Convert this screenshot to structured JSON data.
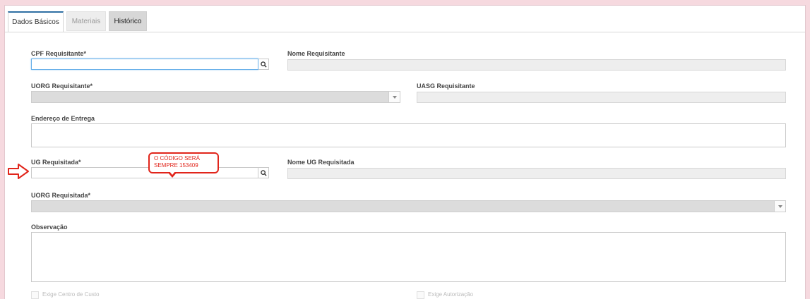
{
  "tabs": [
    "Dados Básicos",
    "Materiais",
    "Histórico"
  ],
  "form": {
    "cpf_requisitante": "CPF Requisitante*",
    "nome_requisitante": "Nome Requisitante",
    "uorg_requisitante": "UORG Requisitante*",
    "uasg_requisitante": "UASG Requisitante",
    "endereco_entrega": "Endereço de Entrega",
    "ug_requisitada": "UG Requisitada*",
    "nome_ug_requisitada": "Nome UG Requisitada",
    "uorg_requisitada": "UORG Requisitada*",
    "observacao": "Observação",
    "partial_left": "Exige Centro de Custo",
    "partial_right": "Exige Autorização"
  },
  "annotation": {
    "line1": "O CÓDIGO SERÁ",
    "line2": "SEMPRE 153409",
    "color": "#e1251b"
  },
  "icons": {
    "search": "search-icon",
    "dropdown": "chevron-down-icon",
    "arrow": "arrow-right-icon"
  },
  "colors": {
    "accent": "#2f6fa3",
    "background": "#f6d9df"
  }
}
